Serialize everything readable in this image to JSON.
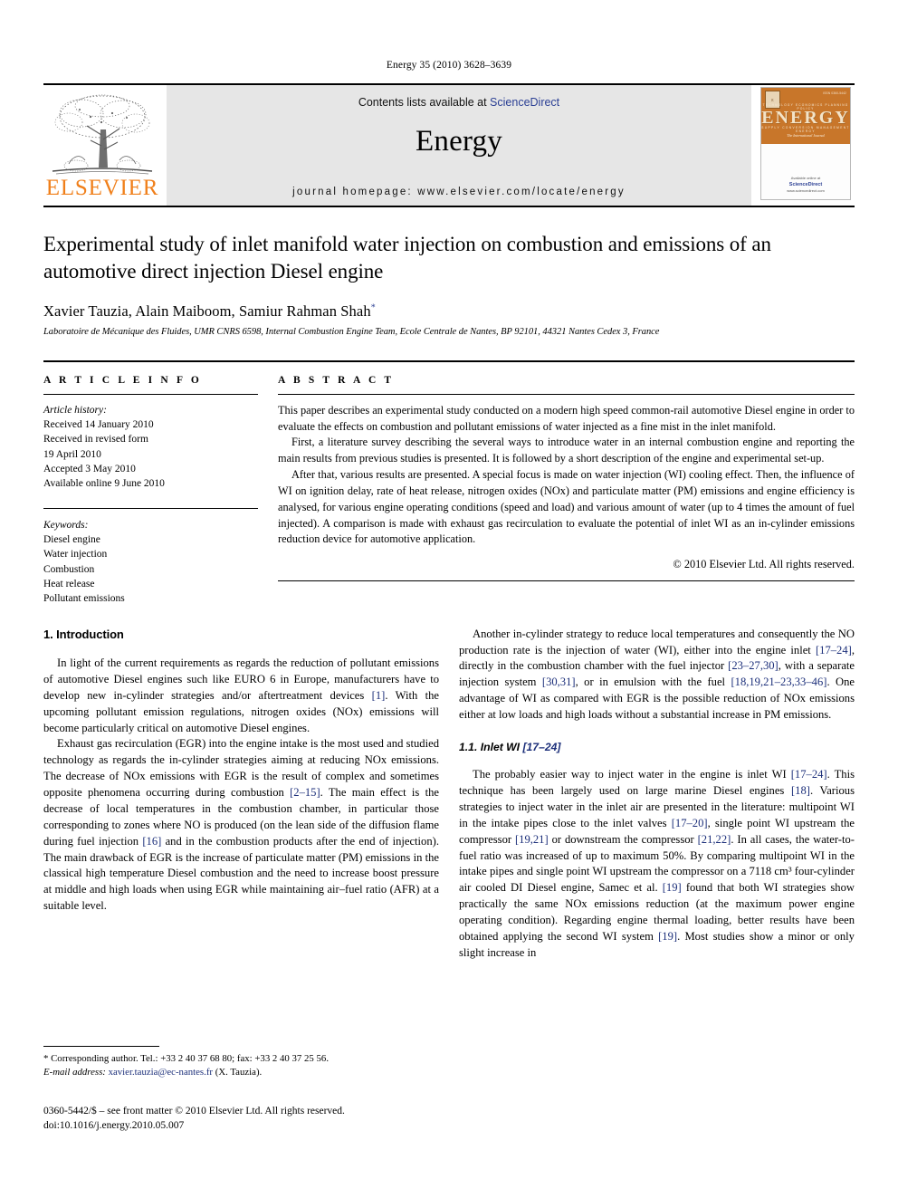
{
  "running_head": "Energy 35 (2010) 3628–3639",
  "masthead": {
    "publisher_name": "ELSEVIER",
    "contents_prefix": "Contents lists available at ",
    "contents_link": "ScienceDirect",
    "journal_title": "Energy",
    "homepage": "journal homepage: www.elsevier.com/locate/energy",
    "cover": {
      "title": "ENERGY",
      "tagline": "The International Journal",
      "top_labels": "TECHNOLOGY     ECONOMICS     PLANNING     POLICY",
      "bottom_labels": "SUPPLY     CONVERSION     MANAGEMENT     ENERGY",
      "issn": "ISSN 0360-5442",
      "logo_text": "E",
      "available_online": "Available online at",
      "sciencedirect": "ScienceDirect",
      "sd_url": "www.sciencedirect.com"
    }
  },
  "article": {
    "title": "Experimental study of inlet manifold water injection on combustion and emissions of an automotive direct injection Diesel engine",
    "authors": "Xavier Tauzia, Alain Maiboom, Samiur Rahman Shah",
    "author_marker": "*",
    "affiliation": "Laboratoire de Mécanique des Fluides, UMR CNRS 6598, Internal Combustion Engine Team, Ecole Centrale de Nantes, BP 92101, 44321 Nantes Cedex 3, France"
  },
  "article_info": {
    "heading": "A R T I C L E   I N F O",
    "history_label": "Article history:",
    "history": [
      "Received 14 January 2010",
      "Received in revised form",
      "19 April 2010",
      "Accepted 3 May 2010",
      "Available online 9 June 2010"
    ],
    "keywords_label": "Keywords:",
    "keywords": [
      "Diesel engine",
      "Water injection",
      "Combustion",
      "Heat release",
      "Pollutant emissions"
    ]
  },
  "abstract": {
    "heading": "A B S T R A C T",
    "paragraphs": [
      "This paper describes an experimental study conducted on a modern high speed common-rail automotive Diesel engine in order to evaluate the effects on combustion and pollutant emissions of water injected as a fine mist in the inlet manifold.",
      "First, a literature survey describing the several ways to introduce water in an internal combustion engine and reporting the main results from previous studies is presented. It is followed by a short description of the engine and experimental set-up.",
      "After that, various results are presented. A special focus is made on water injection (WI) cooling effect. Then, the influence of WI on ignition delay, rate of heat release, nitrogen oxides (NOx) and particulate matter (PM) emissions and engine efficiency is analysed, for various engine operating conditions (speed and load) and various amount of water (up to 4 times the amount of fuel injected). A comparison is made with exhaust gas recirculation to evaluate the potential of inlet WI as an in-cylinder emissions reduction device for automotive application."
    ],
    "copyright": "© 2010 Elsevier Ltd. All rights reserved."
  },
  "body": {
    "section1_heading": "1.  Introduction",
    "left_paragraphs": [
      {
        "parts": [
          {
            "t": "In light of the current requirements as regards the reduction of pollutant emissions of automotive Diesel engines such like EURO 6 in Europe, manufacturers have to develop new in-cylinder strategies and/or aftertreatment devices ",
            "r": false
          },
          {
            "t": "[1]",
            "r": true
          },
          {
            "t": ". With the upcoming pollutant emission regulations, nitrogen oxides (NOx) emissions will become particularly critical on automotive Diesel engines.",
            "r": false
          }
        ]
      },
      {
        "parts": [
          {
            "t": "Exhaust gas recirculation (EGR) into the engine intake is the most used and studied technology as regards the in-cylinder strategies aiming at reducing NOx emissions. The decrease of NOx emissions with EGR is the result of complex and sometimes opposite phenomena occurring during combustion ",
            "r": false
          },
          {
            "t": "[2–15]",
            "r": true
          },
          {
            "t": ". The main effect is the decrease of local temperatures in the combustion chamber, in particular those corresponding to zones where NO is produced (on the lean side of the diffusion flame during fuel injection ",
            "r": false
          },
          {
            "t": "[16]",
            "r": true
          },
          {
            "t": " and in the combustion products after the end of injection). The main drawback of EGR is the increase of particulate matter (PM) emissions in the classical high temperature Diesel combustion and the need to increase boost pressure at middle and high loads when using EGR while maintaining air–fuel ratio (AFR) at a suitable level.",
            "r": false
          }
        ]
      }
    ],
    "right_paragraph_1": {
      "parts": [
        {
          "t": "Another in-cylinder strategy to reduce local temperatures and consequently the NO production rate is the injection of water (WI), either into the engine inlet ",
          "r": false
        },
        {
          "t": "[17–24]",
          "r": true
        },
        {
          "t": ", directly in the combustion chamber with the fuel injector ",
          "r": false
        },
        {
          "t": "[23–27,30]",
          "r": true
        },
        {
          "t": ", with a separate injection system ",
          "r": false
        },
        {
          "t": "[30,31]",
          "r": true
        },
        {
          "t": ", or in emulsion with the fuel ",
          "r": false
        },
        {
          "t": "[18,19,21–23,33–46]",
          "r": true
        },
        {
          "t": ". One advantage of WI as compared with EGR is the possible reduction of NOx emissions either at low loads and high loads without a substantial increase in PM emissions.",
          "r": false
        }
      ]
    },
    "subsection_1_1": {
      "number": "1.1.",
      "label": "Inlet WI",
      "ref": "[17–24]"
    },
    "right_paragraph_2": {
      "parts": [
        {
          "t": "The probably easier way to inject water in the engine is inlet WI ",
          "r": false
        },
        {
          "t": "[17–24]",
          "r": true
        },
        {
          "t": ". This technique has been largely used on large marine Diesel engines ",
          "r": false
        },
        {
          "t": "[18]",
          "r": true
        },
        {
          "t": ". Various strategies to inject water in the inlet air are presented in the literature: multipoint WI in the intake pipes close to the inlet valves ",
          "r": false
        },
        {
          "t": "[17–20]",
          "r": true
        },
        {
          "t": ", single point WI upstream the compressor ",
          "r": false
        },
        {
          "t": "[19,21]",
          "r": true
        },
        {
          "t": " or downstream the compressor ",
          "r": false
        },
        {
          "t": "[21,22]",
          "r": true
        },
        {
          "t": ". In all cases, the water-to-fuel ratio was increased of up to maximum 50%. By comparing multipoint WI in the intake pipes and single point WI upstream the compressor on a 7118 cm³ four-cylinder air cooled DI Diesel engine, Samec et al. ",
          "r": false
        },
        {
          "t": "[19]",
          "r": true
        },
        {
          "t": " found that both WI strategies show practically the same NOx emissions reduction (at the maximum power engine operating condition). Regarding engine thermal loading, better results have been obtained applying the second WI system ",
          "r": false
        },
        {
          "t": "[19]",
          "r": true
        },
        {
          "t": ". Most studies show a minor or only slight increase in",
          "r": false
        }
      ]
    }
  },
  "footnotes": {
    "corresponding": "* Corresponding author. Tel.: +33 2 40 37 68 80; fax: +33 2 40 37 25 56.",
    "email_label": "E-mail address:",
    "email": "xavier.tauzia@ec-nantes.fr",
    "email_suffix": " (X. Tauzia).",
    "imprint_line1": "0360-5442/$ – see front matter © 2010 Elsevier Ltd. All rights reserved.",
    "imprint_line2": "doi:10.1016/j.energy.2010.05.007"
  }
}
